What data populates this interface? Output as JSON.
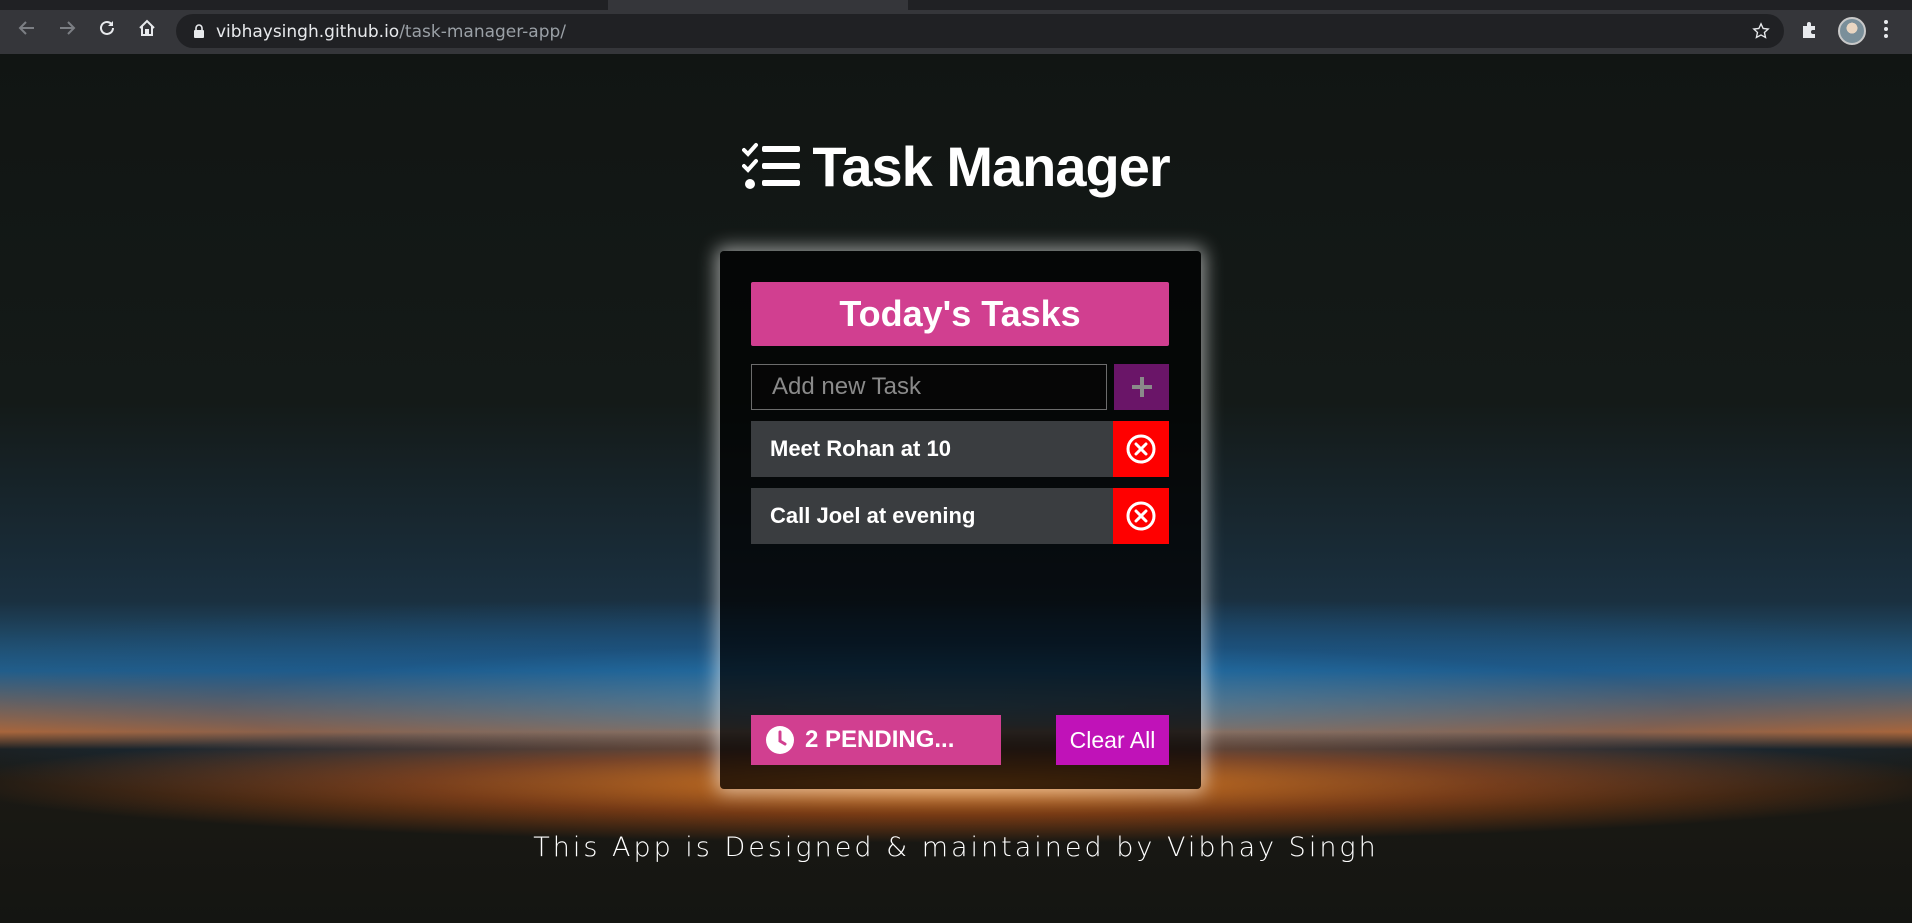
{
  "browser": {
    "url_host": "vibhaysingh.github.io",
    "url_path": "/task-manager-app/",
    "icons": [
      "back-arrow-icon",
      "forward-arrow-icon",
      "reload-icon",
      "home-icon",
      "lock-icon",
      "star-icon",
      "puzzle-icon",
      "menu-dots-icon"
    ]
  },
  "app": {
    "title": "Task Manager",
    "heading": "Today's Tasks",
    "input_placeholder": "Add new Task",
    "input_value": "",
    "tasks": [
      {
        "label": "Meet Rohan at 10"
      },
      {
        "label": "Call Joel at evening"
      }
    ],
    "pending_label": "2 PENDING...",
    "clear_label": "Clear All",
    "footer": "This App is Designed & maintained by Vibhay Singh"
  },
  "colors": {
    "accent_pink": "#d13f90",
    "add_button": "#6a1568",
    "delete_button": "#ff0000",
    "clear_button": "#c012b8",
    "task_row": "#3a3d40"
  }
}
